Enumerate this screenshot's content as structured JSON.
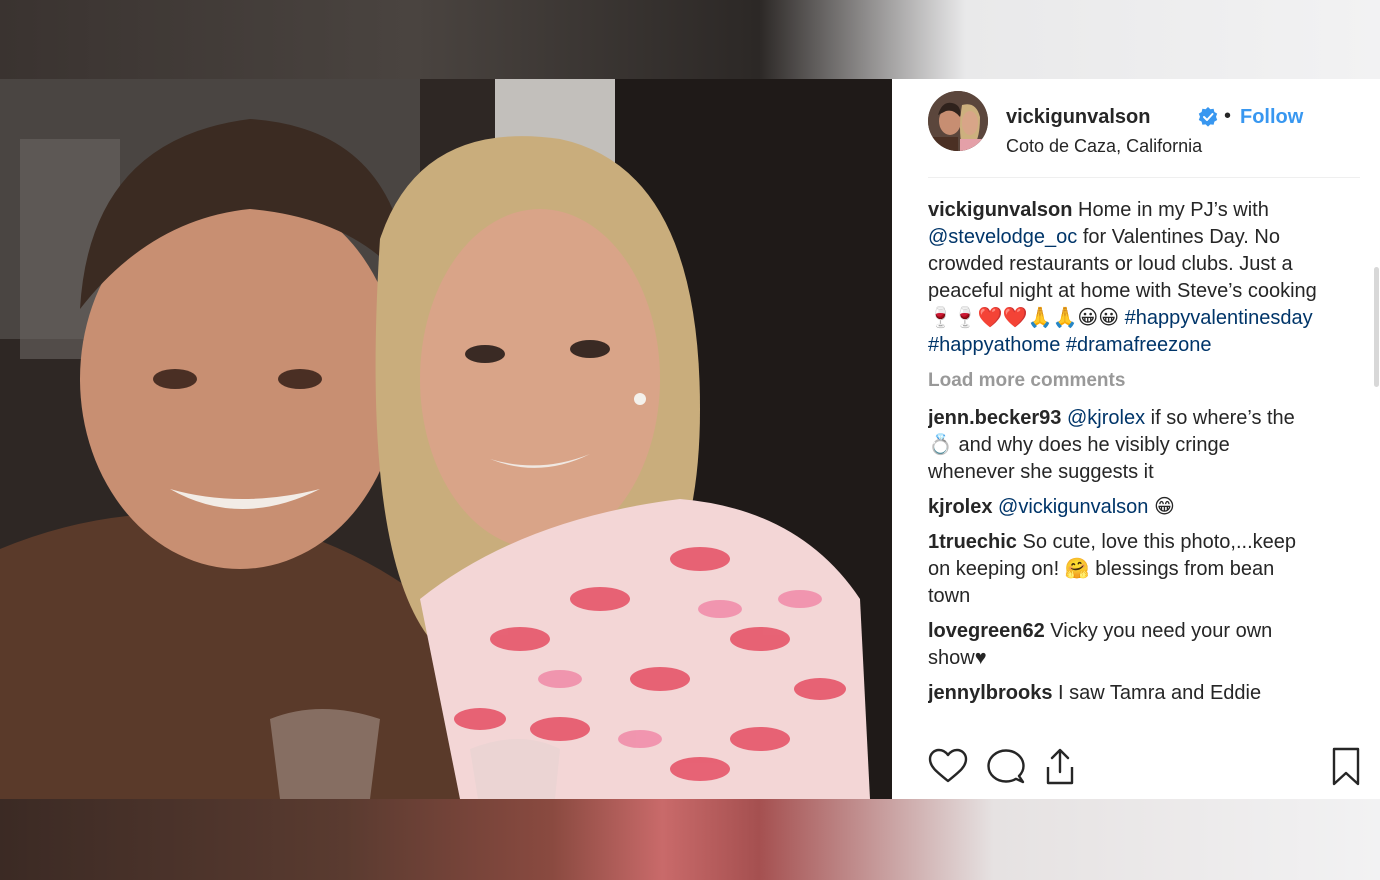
{
  "post": {
    "username": "vickigunvalson",
    "follow_label": "Follow",
    "separator": "•",
    "location": "Coto de Caza, California",
    "caption": {
      "username": "vickigunvalson",
      "text_1": " Home in my PJ’s with ",
      "mention": "@stevelodge_oc",
      "text_2": " for Valentines Day. No crowded restaurants or loud clubs. Just a peaceful night at home with Steve’s cooking 🍷🍷❤️❤️🙏🙏😀😀 ",
      "tag_1": "#happyvalentinesday",
      "tag_2": "#happyathome",
      "tag_3": "#dramafreezone"
    },
    "load_more_label": "Load more comments",
    "comments": [
      {
        "username": "jenn.becker93",
        "mention": "@kjrolex",
        "text": " if so where’s the 💍 and why does he visibly cringe whenever she suggests it"
      },
      {
        "username": "kjrolex",
        "mention": "@vickigunvalson",
        "text": " 😁"
      },
      {
        "username": "1truechic",
        "mention": "",
        "text": " So cute, love this photo,...keep on keeping on! 🤗 blessings from bean town"
      },
      {
        "username": "lovegreen62",
        "mention": "",
        "text": " Vicky you need your own show♥"
      },
      {
        "username": "jennylbrooks",
        "mention": "",
        "text": " I saw Tamra and Eddie"
      }
    ]
  },
  "colors": {
    "link_blue": "#3897f0",
    "mention_blue": "#003569",
    "text": "#262626",
    "muted": "#999999",
    "verified_blue": "#3897f0"
  },
  "icons": {
    "verified": "verified-badge-icon",
    "like": "heart-icon",
    "comment": "comment-bubble-icon",
    "share": "share-icon",
    "save": "bookmark-icon"
  }
}
